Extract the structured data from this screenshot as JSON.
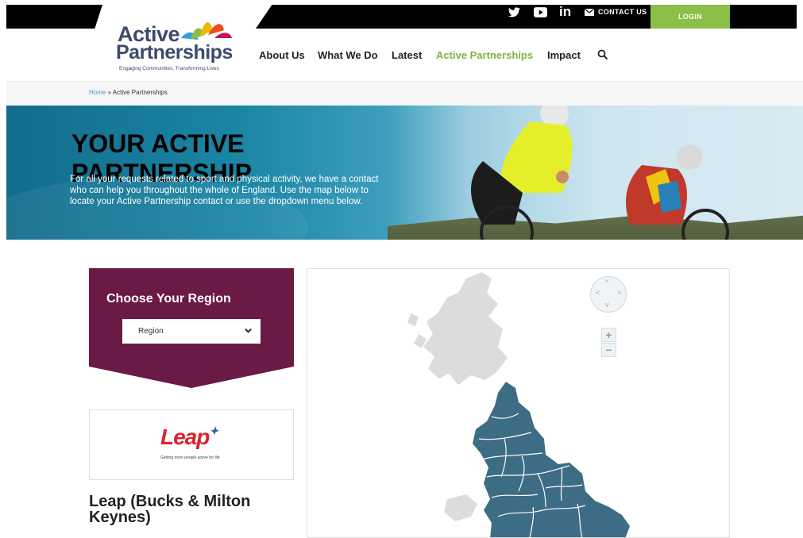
{
  "topbar": {
    "social": [
      "twitter-icon",
      "youtube-icon",
      "linkedin-icon"
    ],
    "contact_label": "CONTACT US",
    "login_label": "LOGIN",
    "login_color": "#8cbf47"
  },
  "logo": {
    "line1": "Active",
    "line2": "Partnerships",
    "tagline": "Engaging Communities, Transforming Lives"
  },
  "nav": {
    "items": [
      "About Us",
      "What We Do",
      "Latest",
      "Active Partnerships",
      "Impact"
    ],
    "active_index": 3,
    "active_color": "#7db33c"
  },
  "breadcrumb": {
    "home": "Home",
    "separator": " » ",
    "current": "Active Partnerships"
  },
  "hero": {
    "title_line1": "YOUR ACTIVE",
    "title_line2": "PARTNERSHIP",
    "text": "For all your requests related to sport and physical activity, we have a contact who can help you throughout the whole of England. Use the map below to locate your Active Partnership contact or use the dropdown menu below."
  },
  "region": {
    "title": "Choose Your Region",
    "select_value": "Region",
    "color": "#6a1a45"
  },
  "partner": {
    "logo_text": "Leap",
    "logo_tagline": "Getting more people active for life",
    "name": "Leap (Bucks & Milton Keynes)"
  },
  "map": {
    "zoom_in": "+",
    "zoom_out": "−",
    "pan_up": "^",
    "pan_down": "v",
    "pan_left": "<",
    "pan_right": ">",
    "england_color": "#3d6d85",
    "other_color": "#dcdcdc"
  }
}
